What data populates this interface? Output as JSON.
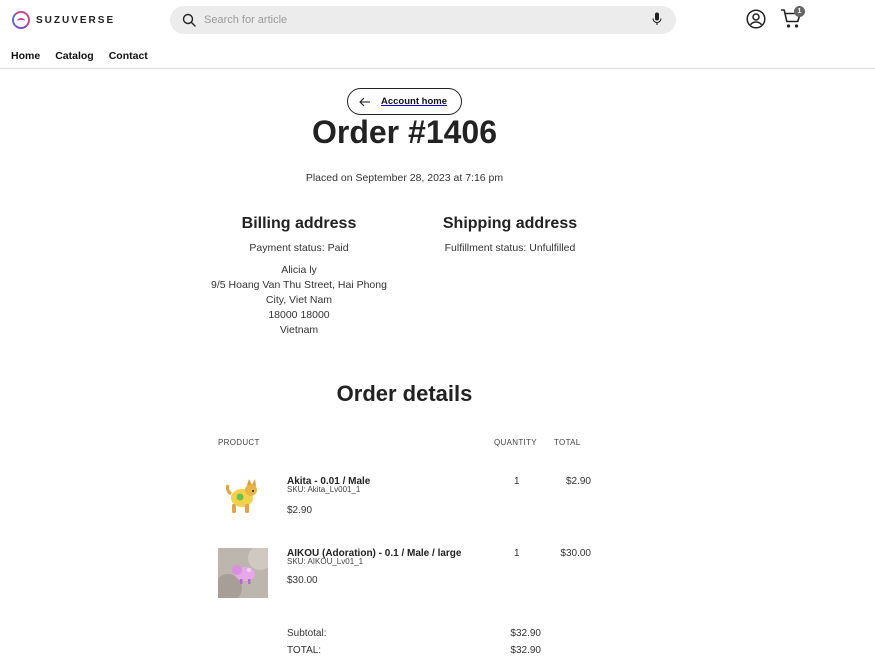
{
  "header": {
    "brand": "SUZUVERSE",
    "search_placeholder": "Search for article",
    "cart_count": "1",
    "icons": [
      "search-icon",
      "mic-icon",
      "account-icon",
      "cart-icon"
    ]
  },
  "nav": {
    "items": [
      {
        "label": "Home"
      },
      {
        "label": "Catalog"
      },
      {
        "label": "Contact"
      }
    ]
  },
  "order": {
    "back_label": "Account home",
    "title": "Order #1406",
    "placed": "Placed on September 28, 2023 at 7:16 pm",
    "billing": {
      "heading": "Billing address",
      "status": "Payment status: Paid",
      "lines": [
        "Alicia ly",
        "9/5 Hoang Van Thu Street, Hai Phong",
        "City, Viet Nam",
        "18000 18000",
        "Vietnam"
      ]
    },
    "shipping": {
      "heading": "Shipping address",
      "status": "Fulfillment status: Unfulfilled"
    }
  },
  "details": {
    "title": "Order details",
    "columns": {
      "product": "PRODUCT",
      "quantity": "QUANTITY",
      "total": "TOTAL"
    },
    "items": [
      {
        "name": "Akita - 0.01 / Male",
        "sku": "SKU: Akita_Lv001_1",
        "price": "$2.90",
        "quantity": "1",
        "total": "$2.90"
      },
      {
        "name": "AIKOU (Adoration) - 0.1 / Male / large",
        "sku": "SKU: AIKOU_Lv01_1",
        "price": "$30.00",
        "quantity": "1",
        "total": "$30.00"
      }
    ],
    "subtotal_label": "Subtotal:",
    "subtotal_value": "$32.90",
    "total_label": "TOTAL:",
    "total_value": "$32.90"
  }
}
